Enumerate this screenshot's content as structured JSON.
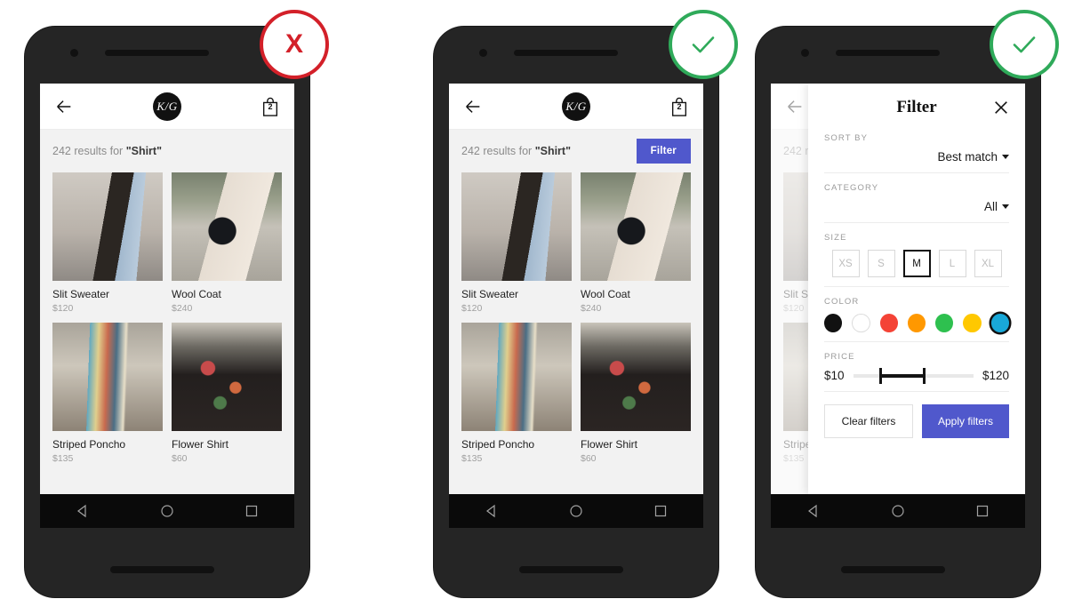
{
  "phones": [
    {
      "id": "phone-no-filter",
      "status": "invalid",
      "status_symbol": "X",
      "has_filter_button": false
    },
    {
      "id": "phone-with-filter",
      "status": "valid",
      "status_symbol": "check",
      "has_filter_button": true
    },
    {
      "id": "phone-filter-panel",
      "status": "valid",
      "status_symbol": "check",
      "has_filter_button": true
    }
  ],
  "app": {
    "header": {
      "back_icon": "arrow-left-icon",
      "logo_text": "K/G",
      "bag_icon": "shopping-bag-icon",
      "bag_count": "2"
    },
    "results": {
      "prefix": "242 results for ",
      "query": "\"Shirt\"",
      "filter_label": "Filter"
    },
    "products": [
      {
        "name": "Slit Sweater",
        "price": "$120",
        "art": "img-slit"
      },
      {
        "name": "Wool Coat",
        "price": "$240",
        "art": "img-wool"
      },
      {
        "name": "Striped Poncho",
        "price": "$135",
        "art": "img-poncho"
      },
      {
        "name": "Flower Shirt",
        "price": "$60",
        "art": "img-flower"
      }
    ],
    "android_nav": {
      "back": "triangle-back-icon",
      "home": "circle-home-icon",
      "recents": "square-recents-icon"
    }
  },
  "filter_panel": {
    "title": "Filter",
    "close_icon": "close-icon",
    "sort_by": {
      "label": "SORT BY",
      "value": "Best match"
    },
    "category": {
      "label": "CATEGORY",
      "value": "All"
    },
    "size": {
      "label": "SIZE",
      "options": [
        "XS",
        "S",
        "M",
        "L",
        "XL"
      ],
      "selected": "M"
    },
    "color": {
      "label": "COLOR",
      "options": [
        {
          "name": "black",
          "hex": "#111111"
        },
        {
          "name": "white",
          "hex": "#ffffff"
        },
        {
          "name": "red",
          "hex": "#f44336"
        },
        {
          "name": "orange",
          "hex": "#ff9800"
        },
        {
          "name": "green",
          "hex": "#2ec04f"
        },
        {
          "name": "yellow",
          "hex": "#ffc800"
        },
        {
          "name": "blue",
          "hex": "#19a8d8"
        }
      ],
      "selected": "blue"
    },
    "price": {
      "label": "PRICE",
      "min": "$10",
      "max": "$120"
    },
    "clear_label": "Clear filters",
    "apply_label": "Apply filters"
  },
  "colors": {
    "accent_blue": "#5058cc",
    "invalid_red": "#d32029",
    "valid_green": "#2faa5a",
    "screen_bg": "#f2f2f2",
    "phone_body": "#252525"
  }
}
